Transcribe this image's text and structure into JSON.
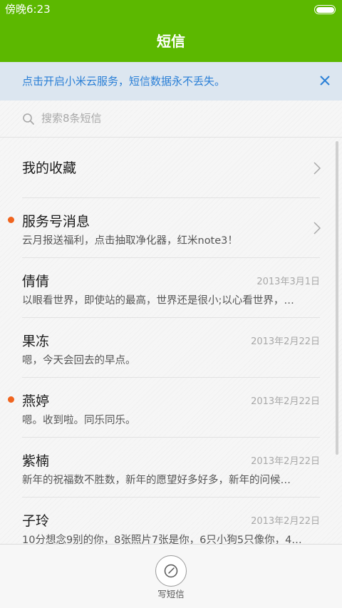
{
  "status_bar": {
    "time": "傍晚6:23",
    "battery_icon": "battery-icon"
  },
  "header": {
    "title": "短信",
    "background_color": "#5cb800"
  },
  "banner": {
    "text": "点击开启小米云服务，短信数据永不丢失。",
    "close_icon": "close-icon",
    "text_color": "#2a7fd6"
  },
  "search": {
    "placeholder": "搜索8条短信",
    "icon": "search-icon"
  },
  "conversations": [
    {
      "name": "我的收藏",
      "preview": "",
      "date": "",
      "unread": false,
      "chevron": true
    },
    {
      "name": "服务号消息",
      "preview": "云月报送福利，点击抽取净化器，红米note3！",
      "date": "",
      "unread": true,
      "chevron": true
    },
    {
      "name": "倩倩",
      "preview": "以眼看世界，即使站的最高，世界还是很小;以心看世界，…",
      "date": "2013年3月1日",
      "unread": false,
      "chevron": false
    },
    {
      "name": "果冻",
      "preview": "嗯，今天会回去的早点。",
      "date": "2013年2月22日",
      "unread": false,
      "chevron": false
    },
    {
      "name": "燕婷",
      "preview": "嗯。收到啦。同乐同乐。",
      "date": "2013年2月22日",
      "unread": true,
      "chevron": false
    },
    {
      "name": "紫楠",
      "preview": "新年的祝福数不胜数，新年的愿望好多好多，新年的问候…",
      "date": "2013年2月22日",
      "unread": false,
      "chevron": false
    },
    {
      "name": "子玲",
      "preview": "10分想念9别的你，8张照片7张是你，6只小狗5只像你，4…",
      "date": "2013年2月22日",
      "unread": false,
      "chevron": false
    }
  ],
  "unread_dot_color": "#f0641e",
  "bottom_bar": {
    "compose_label": "写短信",
    "compose_icon": "compose-icon"
  }
}
